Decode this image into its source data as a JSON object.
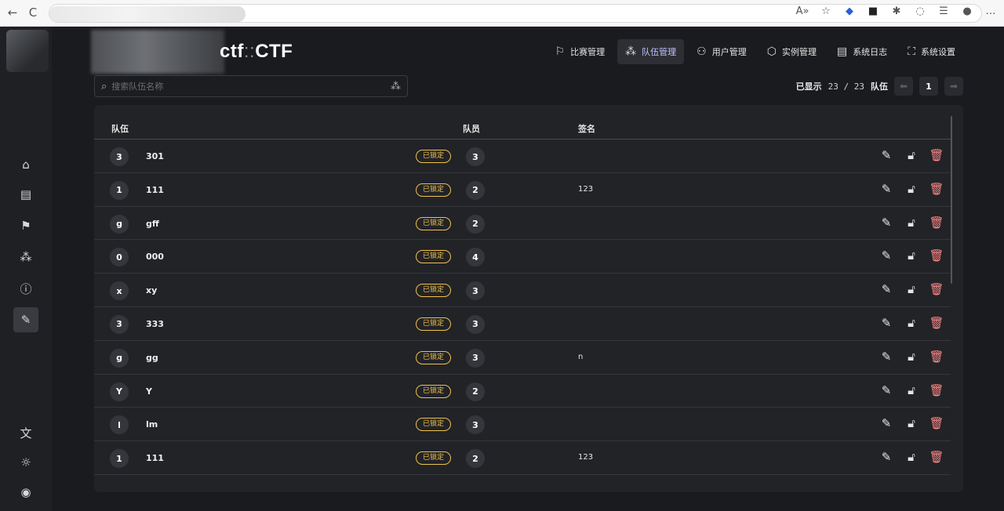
{
  "browser": {
    "back": "←",
    "reload": "C",
    "icons": [
      "read-aloud",
      "favorites-star",
      "extension-diamond",
      "extension-square",
      "extension-gear",
      "collections",
      "favorites-bar",
      "profile",
      "more"
    ]
  },
  "app": {
    "brand": {
      "prefix": "ctf",
      "sep": "::",
      "suffix": "CTF"
    },
    "topnav": [
      {
        "label": "比赛管理",
        "icon": "flag-icon"
      },
      {
        "label": "队伍管理",
        "icon": "team-icon",
        "active": true
      },
      {
        "label": "用户管理",
        "icon": "user-gear-icon"
      },
      {
        "label": "实例管理",
        "icon": "box-icon"
      },
      {
        "label": "系统日志",
        "icon": "log-icon"
      },
      {
        "label": "系统设置",
        "icon": "sitemap-icon"
      }
    ],
    "search": {
      "placeholder": "搜索队伍名称"
    },
    "pager": {
      "showing": "已显示",
      "count": "23 / 23",
      "unit": "队伍",
      "page": "1"
    },
    "table": {
      "headers": {
        "team": "队伍",
        "members": "队员",
        "signature": "签名"
      },
      "locked_label": "已锁定",
      "rows": [
        {
          "avatar": "3",
          "name": "301",
          "members": "3",
          "signature": ""
        },
        {
          "avatar": "1",
          "name": "111",
          "members": "2",
          "signature": "123"
        },
        {
          "avatar": "g",
          "name": "gff",
          "members": "2",
          "signature": ""
        },
        {
          "avatar": "0",
          "name": "000",
          "members": "4",
          "signature": ""
        },
        {
          "avatar": "x",
          "name": "xy",
          "members": "3",
          "signature": ""
        },
        {
          "avatar": "3",
          "name": "333",
          "members": "3",
          "signature": ""
        },
        {
          "avatar": "g",
          "name": "gg",
          "members": "3",
          "signature": "n"
        },
        {
          "avatar": "Y",
          "name": "Y",
          "members": "2",
          "signature": ""
        },
        {
          "avatar": "l",
          "name": "lm",
          "members": "3",
          "signature": ""
        },
        {
          "avatar": "1",
          "name": "111",
          "members": "2",
          "signature": "123"
        }
      ]
    },
    "sidebar_icons": [
      "home-icon",
      "post-icon",
      "flag-icon",
      "team-icon",
      "info-icon",
      "wrench-icon",
      "translate-icon",
      "brightness-icon",
      "account-icon"
    ],
    "colors": {
      "accent": "#f0c24b",
      "delete": "#ff8787",
      "background": "#1a1b1e"
    }
  }
}
